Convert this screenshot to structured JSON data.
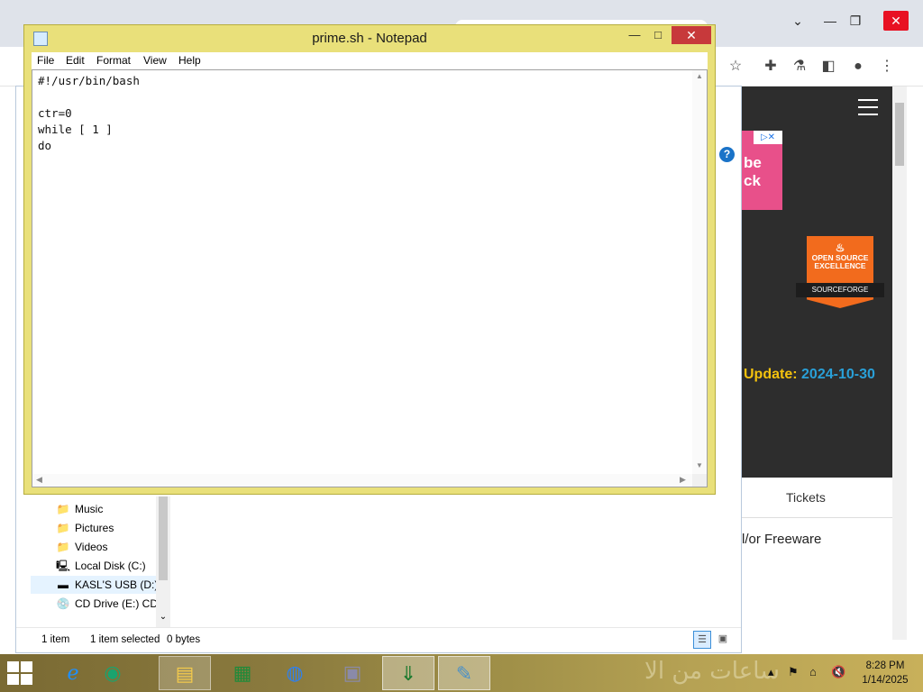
{
  "notepad": {
    "title": "prime.sh - Notepad",
    "buttons": {
      "minimize": "—",
      "maximize": "□",
      "close": "✕"
    },
    "menu": [
      "File",
      "Edit",
      "Format",
      "View",
      "Help"
    ],
    "content": "#!/usr/bin/bash\n\nctr=0\nwhile [ 1 ]\ndo"
  },
  "explorer": {
    "nav_items": [
      {
        "label": "Music",
        "icon": "music-folder-icon",
        "glyph": "📁"
      },
      {
        "label": "Pictures",
        "icon": "pictures-folder-icon",
        "glyph": "📁"
      },
      {
        "label": "Videos",
        "icon": "videos-folder-icon",
        "glyph": "📁"
      },
      {
        "label": "Local Disk (C:)",
        "icon": "local-disk-icon",
        "glyph": "💻"
      },
      {
        "label": "KASL'S USB (D:)",
        "icon": "usb-drive-icon",
        "glyph": "▬"
      },
      {
        "label": "CD Drive (E:) CDR",
        "icon": "cd-drive-icon",
        "glyph": "💿"
      }
    ],
    "status": {
      "items": "1 item",
      "selected": "1 item selected",
      "size": "0 bytes"
    }
  },
  "browser": {
    "ad_text": "be\nck",
    "badge": {
      "line1": "OPEN SOURCE",
      "line2": "EXCELLENCE",
      "brand": "SOURCEFORGE"
    },
    "update_label": "Update:",
    "update_date": "2024-10-30",
    "tickets": "Tickets",
    "freeware": "l/or Freeware"
  },
  "taskbar": {
    "arabic_text": "ساعات من الا",
    "time": "8:28 PM",
    "date": "1/14/2025"
  }
}
